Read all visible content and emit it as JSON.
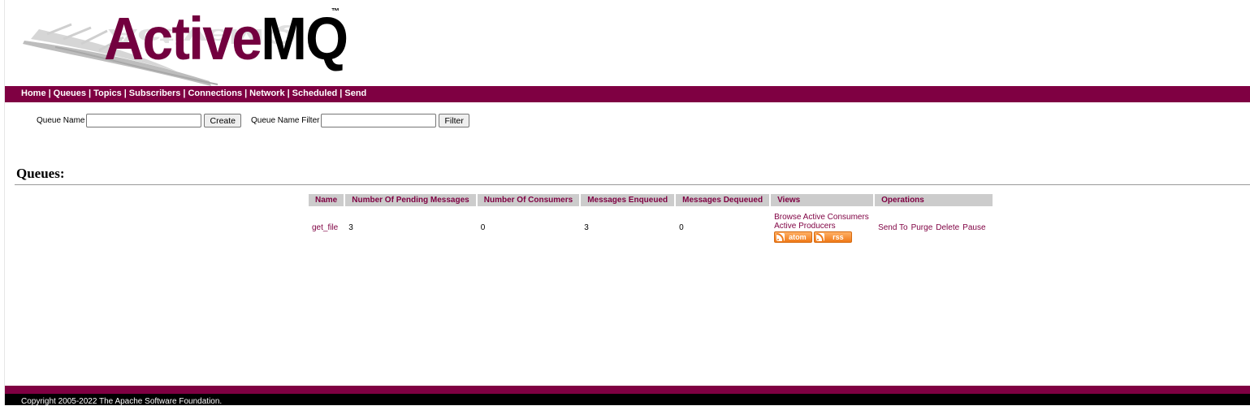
{
  "logo": {
    "text_active": "Active",
    "text_mq": "MQ",
    "trademark": "™"
  },
  "nav": {
    "items": [
      {
        "label": "Home"
      },
      {
        "label": "Queues"
      },
      {
        "label": "Topics"
      },
      {
        "label": "Subscribers"
      },
      {
        "label": "Connections"
      },
      {
        "label": "Network"
      },
      {
        "label": "Scheduled"
      },
      {
        "label": "Send"
      }
    ],
    "separator": "|"
  },
  "form": {
    "queue_name_label": "Queue Name",
    "queue_name_value": "",
    "create_label": "Create",
    "filter_label": "Queue Name Filter",
    "filter_value": "",
    "filter_button": "Filter"
  },
  "section": {
    "title": "Queues:"
  },
  "table": {
    "headers": [
      "Name",
      "Number Of Pending Messages",
      "Number Of Consumers",
      "Messages Enqueued",
      "Messages Dequeued",
      "Views",
      "Operations"
    ],
    "rows": [
      {
        "name": "get_file",
        "pending": "3",
        "consumers": "0",
        "enqueued": "3",
        "dequeued": "0",
        "views": {
          "browse": "Browse",
          "active_consumers": "Active Consumers",
          "active_producers": "Active Producers",
          "atom": "atom",
          "rss": "rss"
        },
        "operations": {
          "send_to": "Send To",
          "purge": "Purge",
          "delete": "Delete",
          "pause": "Pause"
        }
      }
    ]
  },
  "footer": {
    "copyright": "Copyright 2005-2022 The Apache Software Foundation."
  },
  "colors": {
    "brand": "#7f0042",
    "header_bg": "#cccccc",
    "feed": "#f07a18"
  }
}
